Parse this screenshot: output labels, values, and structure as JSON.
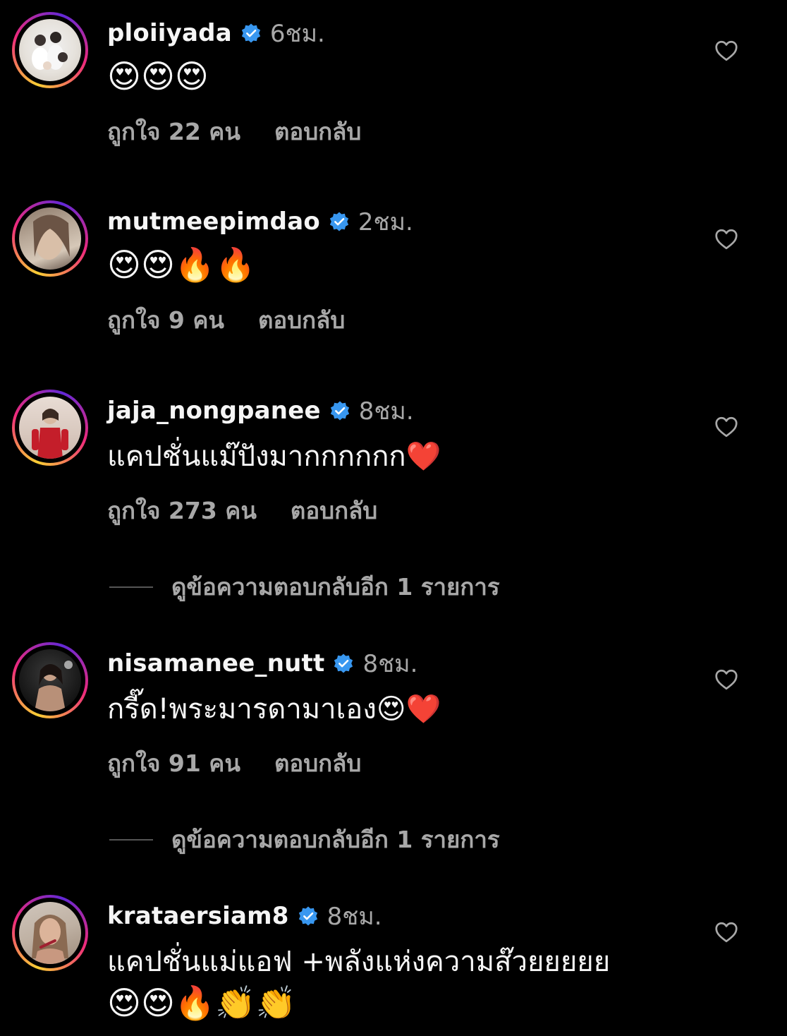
{
  "comments": [
    {
      "username": "ploiiyada",
      "time": "6ชม.",
      "text": "😍😍😍",
      "likes": "ถูกใจ 22 คน",
      "reply": "ตอบกลับ"
    },
    {
      "username": "mutmeepimdao",
      "time": "2ชม.",
      "text": "😍😍🔥🔥",
      "likes": "ถูกใจ 9 คน",
      "reply": "ตอบกลับ"
    },
    {
      "username": "jaja_nongpanee",
      "time": "8ชม.",
      "text": "แคปชั่นแม๊ปังมากกกกกก❤️",
      "likes": "ถูกใจ 273 คน",
      "reply": "ตอบกลับ",
      "view_replies": "ดูข้อความตอบกลับอีก 1 รายการ"
    },
    {
      "username": "nisamanee_nutt",
      "time": "8ชม.",
      "text": "กรี๊ด!พระมารดามาเอง😍❤️",
      "likes": "ถูกใจ 91 คน",
      "reply": "ตอบกลับ",
      "view_replies": "ดูข้อความตอบกลับอีก 1 รายการ"
    },
    {
      "username": "krataersiam8",
      "time": "8ชม.",
      "text": "แคปชั่นแม่แอฟ +พลังแห่งความส๊วยยยยย",
      "text_line2": "😍😍🔥👏👏"
    }
  ],
  "colors": {
    "background": "#000000",
    "text": "#f5f5f5",
    "secondary": "#a8a8a8",
    "verified": "#3897f0"
  }
}
